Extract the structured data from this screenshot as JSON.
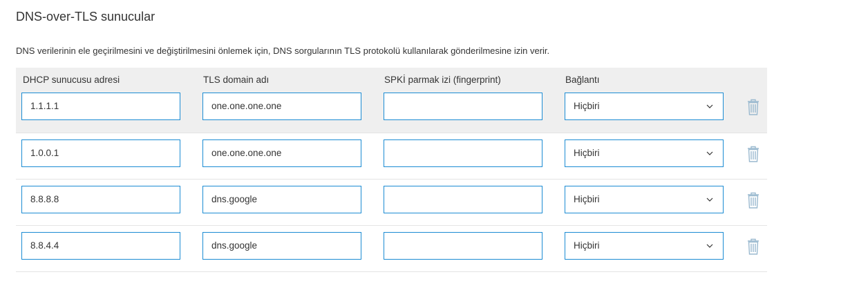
{
  "section": {
    "title": "DNS-over-TLS sunucular",
    "description": "DNS verilerinin ele geçirilmesini ve değiştirilmesini önlemek için, DNS sorgularının TLS protokolü kullanılarak gönderilmesine izin verir."
  },
  "table": {
    "headers": [
      "DHCP sunucusu adresi",
      "TLS domain adı",
      "SPKİ parmak izi (fingerprint)",
      "Bağlantı"
    ],
    "rows": [
      {
        "address": "1.1.1.1",
        "domain": "one.one.one.one",
        "fingerprint": "",
        "connection": "Hiçbiri"
      },
      {
        "address": "1.0.0.1",
        "domain": "one.one.one.one",
        "fingerprint": "",
        "connection": "Hiçbiri"
      },
      {
        "address": "8.8.8.8",
        "domain": "dns.google",
        "fingerprint": "",
        "connection": "Hiçbiri"
      },
      {
        "address": "8.8.4.4",
        "domain": "dns.google",
        "fingerprint": "",
        "connection": "Hiçbiri"
      }
    ]
  },
  "icons": {
    "select": "chevron-down-icon",
    "delete": "trash-icon"
  },
  "colors": {
    "accent": "#1a8bd3",
    "header_bg": "#efefef",
    "icon": "#9ab9cf"
  }
}
